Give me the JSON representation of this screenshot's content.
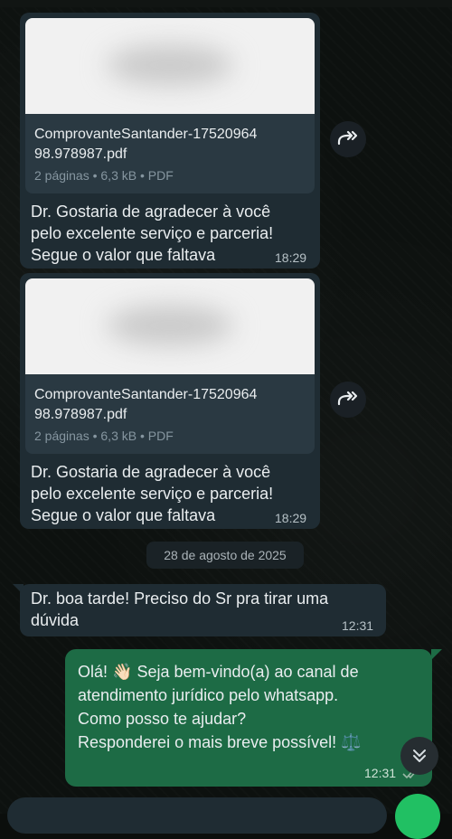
{
  "messages": [
    {
      "file_name": "ComprovanteSantander-1752096498.978987.pdf",
      "file_name_line1": "ComprovanteSantander-17520964",
      "file_name_line2": "98.978987.pdf",
      "file_meta": "2 páginas • 6,3 kB • PDF",
      "text_line1": "Dr. Gostaria de agradecer à você",
      "text_line2": "pelo excelente serviço e parceria!",
      "text_line3": "Segue o valor que faltava",
      "time": "18:29"
    },
    {
      "file_name": "ComprovanteSantander-1752096498.978987.pdf",
      "file_name_line1": "ComprovanteSantander-17520964",
      "file_name_line2": "98.978987.pdf",
      "file_meta": "2 páginas • 6,3 kB • PDF",
      "text_line1": "Dr. Gostaria de agradecer à você",
      "text_line2": "pelo excelente serviço e parceria!",
      "text_line3": "Segue o valor que faltava",
      "time": "18:29"
    }
  ],
  "date_separator": "28 de agosto de 2025",
  "incoming_question": {
    "line1": "Dr. boa tarde! Preciso do Sr pra tirar uma",
    "line2": "dúvida",
    "time": "12:31"
  },
  "outgoing_reply": {
    "line1_a": "Olá! ",
    "wave_emoji": "👋🏻",
    "line1_b": " Seja bem-vindo(a) ao canal de",
    "line2": "atendimento jurídico pelo whatsapp.",
    "line3": "Como posso te ajudar?",
    "line4": "Responderei o mais breve possível! ",
    "scales_emoji": "⚖️",
    "time": "12:31"
  },
  "icons": {
    "forward": "forward-icon",
    "scroll_down": "double-chevron-down-icon",
    "read_receipt": "double-check-icon",
    "mic": "mic-icon"
  },
  "colors": {
    "incoming_bubble": "#1f2c33",
    "outgoing_bubble": "#1d6b45",
    "accent_green": "#21c063"
  }
}
